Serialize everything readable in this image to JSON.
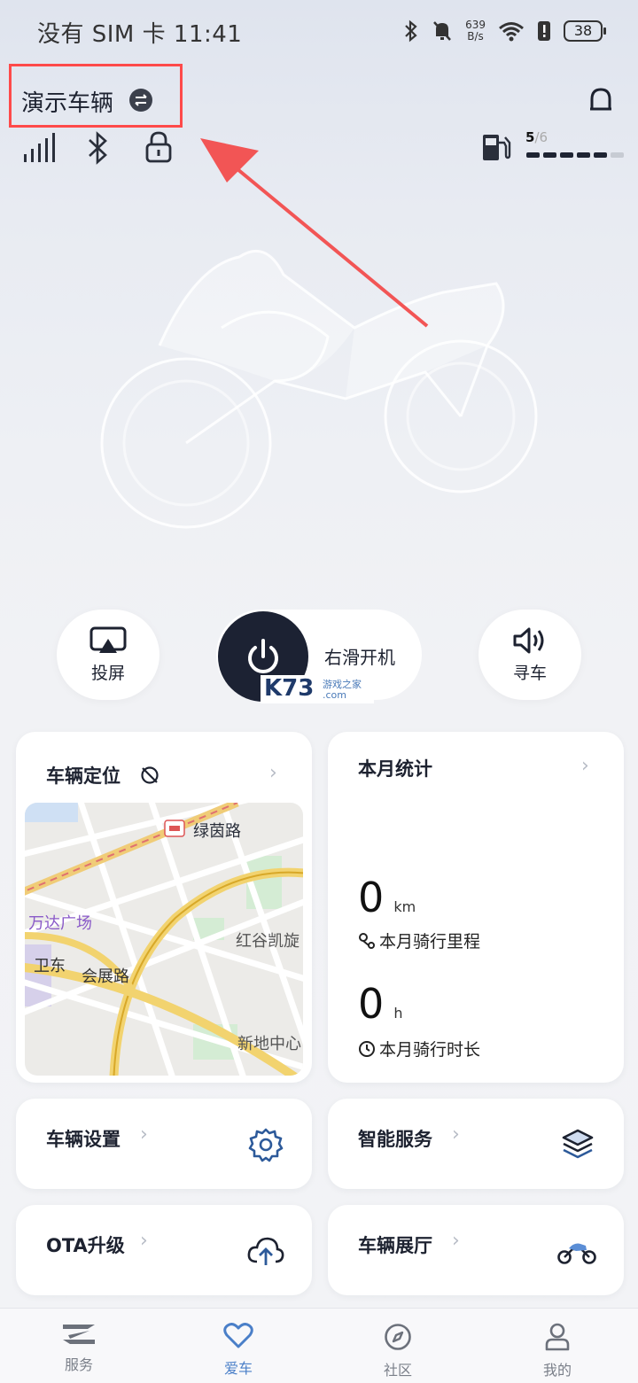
{
  "status_bar": {
    "carrier": "没有 SIM 卡 11:41",
    "net_speed_value": "639",
    "net_speed_unit": "B/s",
    "battery": "38"
  },
  "header": {
    "vehicle_name": "演示车辆"
  },
  "fuel": {
    "level_text": "5",
    "level_max": "/6",
    "level": 5,
    "max": 6
  },
  "quick_actions": {
    "cast_label": "投屏",
    "slide_label": "右滑开机",
    "find_car_label": "寻车"
  },
  "watermark": {
    "text": "K73",
    "sub": "游戏之家",
    "domain": ".com"
  },
  "location_card": {
    "title": "车辆定位",
    "map_labels": {
      "road1": "绿茵路",
      "place1": "万达广场",
      "place2": "红谷凯旋",
      "place3": "卫东",
      "road2": "会展路",
      "place4": "新地中心"
    }
  },
  "stats_card": {
    "title": "本月统计",
    "distance_value": "0",
    "distance_unit": "km",
    "distance_label": "本月骑行里程",
    "time_value": "0",
    "time_unit": "h",
    "time_label": "本月骑行时长"
  },
  "feature_cards": {
    "settings": "车辆设置",
    "smart_service": "智能服务",
    "ota": "OTA升级",
    "showroom": "车辆展厅"
  },
  "bottom_nav": {
    "items": [
      {
        "label": "服务",
        "icon": "service-logo-icon"
      },
      {
        "label": "爱车",
        "icon": "heart-icon"
      },
      {
        "label": "社区",
        "icon": "compass-icon"
      },
      {
        "label": "我的",
        "icon": "person-icon"
      }
    ],
    "active_index": 1
  },
  "colors": {
    "accent": "#4a7fc8",
    "annotation_red": "#ff4a4a",
    "dark": "#1c2233"
  }
}
